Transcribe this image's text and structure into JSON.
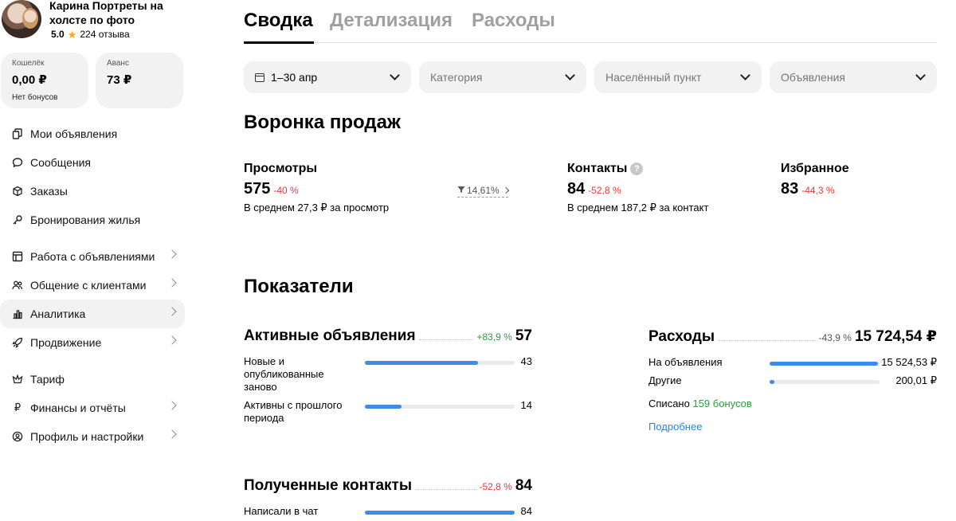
{
  "profile": {
    "name": "Карина Портреты на холсте по фото",
    "score": "5.0",
    "reviews": "224 отзыва"
  },
  "wallets": [
    {
      "title": "Кошелёк",
      "amount": "0,00 ₽",
      "sub": "Нет бонусов"
    },
    {
      "title": "Аванс",
      "amount": "73 ₽",
      "sub": ""
    }
  ],
  "nav": [
    {
      "label": "Мои объявления",
      "icon": "copy-icon"
    },
    {
      "label": "Сообщения",
      "icon": "chat-icon"
    },
    {
      "label": "Заказы",
      "icon": "box-icon"
    },
    {
      "label": "Бронирования жилья",
      "icon": "key-icon"
    },
    {
      "label": "Работа с объявлениями",
      "icon": "listing-tools-icon"
    },
    {
      "label": "Общение с клиентами",
      "icon": "people-icon"
    },
    {
      "label": "Аналитика",
      "icon": "bar-chart-icon"
    },
    {
      "label": "Продвижение",
      "icon": "rocket-icon"
    },
    {
      "label": "Тариф",
      "icon": "tariff-icon"
    },
    {
      "label": "Финансы и отчёты",
      "icon": "ruble-icon"
    },
    {
      "label": "Профиль и настройки",
      "icon": "user-circle-icon"
    }
  ],
  "tabs": [
    "Сводка",
    "Детализация",
    "Расходы"
  ],
  "filters": {
    "date": "1–30 апр",
    "category": "Категория",
    "location": "Населённый пункт",
    "listings": "Объявления"
  },
  "funnel": {
    "title": "Воронка продаж",
    "views": {
      "label": "Просмотры",
      "value": "575",
      "delta": "-40 %",
      "sub": "В среднем 27,3 ₽ за просмотр",
      "conversion": "14,61%"
    },
    "contacts": {
      "label": "Контакты",
      "help": "?",
      "value": "84",
      "delta": "-52,8 %",
      "sub": "В среднем 187,2 ₽ за контакт"
    },
    "favorites": {
      "label": "Избранное",
      "value": "83",
      "delta": "-44,3 %"
    }
  },
  "metrics": {
    "title": "Показатели",
    "active": {
      "title": "Активные объявления",
      "delta": "+83,9 %",
      "value": "57",
      "rows": [
        {
          "label": "Новые и опубликованные заново",
          "value": "43",
          "fill": 0.754
        },
        {
          "label": "Активны с прошлого периода",
          "value": "14",
          "fill": 0.246
        }
      ]
    },
    "expenses": {
      "title": "Расходы",
      "delta": "-43,9 %",
      "value": "15 724,54 ₽",
      "rows": [
        {
          "label": "На объявления",
          "value": "15 524,53 ₽",
          "fill": 0.987
        },
        {
          "label": "Другие",
          "value": "200,01 ₽",
          "fill": 0.04
        }
      ],
      "written_off_prefix": "Списано",
      "written_off_bonus": "159 бонусов",
      "more": "Подробнее"
    },
    "contacts": {
      "title": "Полученные контакты",
      "delta": "-52,8 %",
      "value": "84",
      "rows": [
        {
          "label": "Написали в чат",
          "value": "84",
          "fill": 1.0
        }
      ]
    }
  },
  "colors": {
    "accent_blue": "#3d8de8",
    "positive": "#2e9b3b",
    "negative": "#e53935",
    "link": "#1e88e5",
    "star": "#f5a623"
  }
}
